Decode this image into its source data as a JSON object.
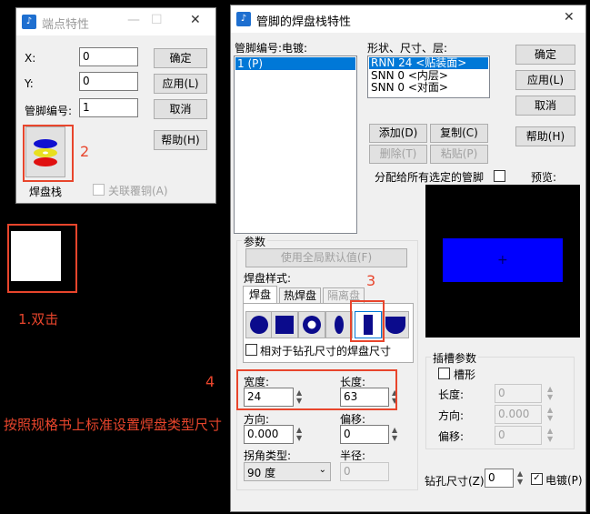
{
  "endpoint_dialog": {
    "title": "端点特性",
    "x_label": "X:",
    "x_value": "0",
    "y_label": "Y:",
    "y_value": "0",
    "pin_label": "管脚编号:",
    "pin_value": "1",
    "ok": "确定",
    "apply": "应用(L)",
    "cancel": "取消",
    "help": "帮助(H)",
    "padstack_label": "焊盘栈",
    "link_copper_label": "关联覆铜(A)"
  },
  "padstack_dialog": {
    "title": "管脚的焊盘栈特性",
    "pin_plating_header": "管脚编号:电镀:",
    "pin_items": [
      "1 (P)"
    ],
    "shape_header": "形状、尺寸、层:",
    "shape_items": [
      "RNN 24 <贴装面>",
      "SNN 0 <内层>",
      "SNN 0 <对面>"
    ],
    "ok": "确定",
    "apply": "应用(L)",
    "cancel": "取消",
    "help": "帮助(H)",
    "add": "添加(D)",
    "copy": "复制(C)",
    "delete": "删除(T)",
    "paste": "粘贴(P)",
    "assign_all_label": "分配给所有选定的管脚",
    "preview_label": "预览:",
    "params_group": "参数",
    "use_default": "使用全局默认值(F)",
    "pad_style_label": "焊盘样式:",
    "tabs": [
      "焊盘",
      "热焊盘",
      "隔离盘"
    ],
    "relative_drill_label": "相对于钻孔尺寸的焊盘尺寸",
    "width_label": "宽度:",
    "width_value": "24",
    "length_label": "长度:",
    "length_value": "63",
    "orientation_label": "方向:",
    "orientation_value": "0.000",
    "offset_label": "偏移:",
    "offset_value": "0",
    "corner_type_label": "拐角类型:",
    "corner_type_value": "90 度",
    "radius_label": "半径:",
    "radius_value": "0",
    "slot_group": "插槽参数",
    "slotted_label": "槽形",
    "slot_length_label": "长度:",
    "slot_length_value": "0",
    "slot_orientation_label": "方向:",
    "slot_orientation_value": "0.000",
    "slot_offset_label": "偏移:",
    "slot_offset_value": "0",
    "drill_size_label": "钻孔尺寸(Z):",
    "drill_size_value": "0",
    "plated_label": "电镀(P)"
  },
  "annotations": {
    "a1": "1.双击",
    "a2": "2",
    "a3": "3",
    "a4": "4",
    "note": "按照规格书上标准设置焊盘类型尺寸"
  },
  "colors": {
    "accent_red": "#e8452c",
    "selection_blue": "#0078d7",
    "preview_pad": "#0000ff"
  }
}
